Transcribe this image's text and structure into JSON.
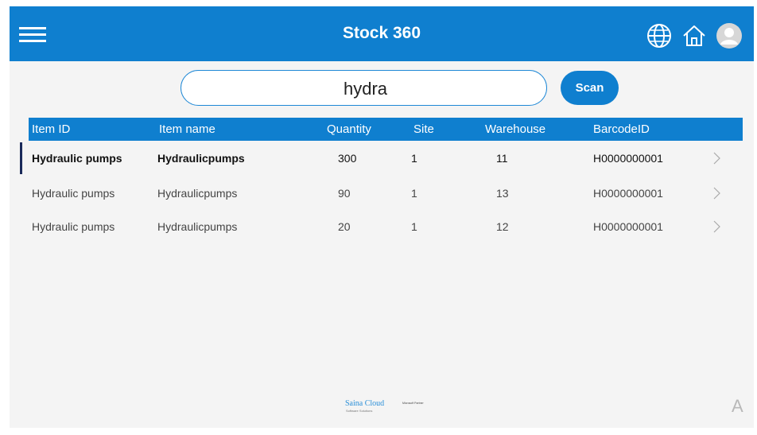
{
  "header": {
    "title": "Stock 360",
    "icons": [
      "menu-icon",
      "globe-icon",
      "home-icon",
      "user-avatar-icon"
    ],
    "background_color": "#0f7fcf"
  },
  "search": {
    "value": "hydra",
    "button_label": "Scan"
  },
  "table": {
    "columns": [
      "Item ID",
      "Item name",
      "Quantity",
      "Site",
      "Warehouse",
      "BarcodeID"
    ],
    "rows": [
      {
        "item_id": "Hydraulic pumps",
        "item_name": "Hydraulicpumps",
        "quantity": "300",
        "site": "1",
        "warehouse": "11",
        "barcode": "H0000000001"
      },
      {
        "item_id": "Hydraulic pumps",
        "item_name": "Hydraulicpumps",
        "quantity": "90",
        "site": "1",
        "warehouse": "13",
        "barcode": "H0000000001"
      },
      {
        "item_id": "Hydraulic pumps",
        "item_name": "Hydraulicpumps",
        "quantity": "20",
        "site": "1",
        "warehouse": "12",
        "barcode": "H0000000001"
      }
    ],
    "selected_row": 0,
    "row_icon": "chevron-right-icon"
  },
  "footer": {
    "logo_text": "Saina Cloud",
    "logo_subtext": "Software Solutions",
    "partner_text": "Microsoft Partner"
  },
  "corner_text": "A"
}
